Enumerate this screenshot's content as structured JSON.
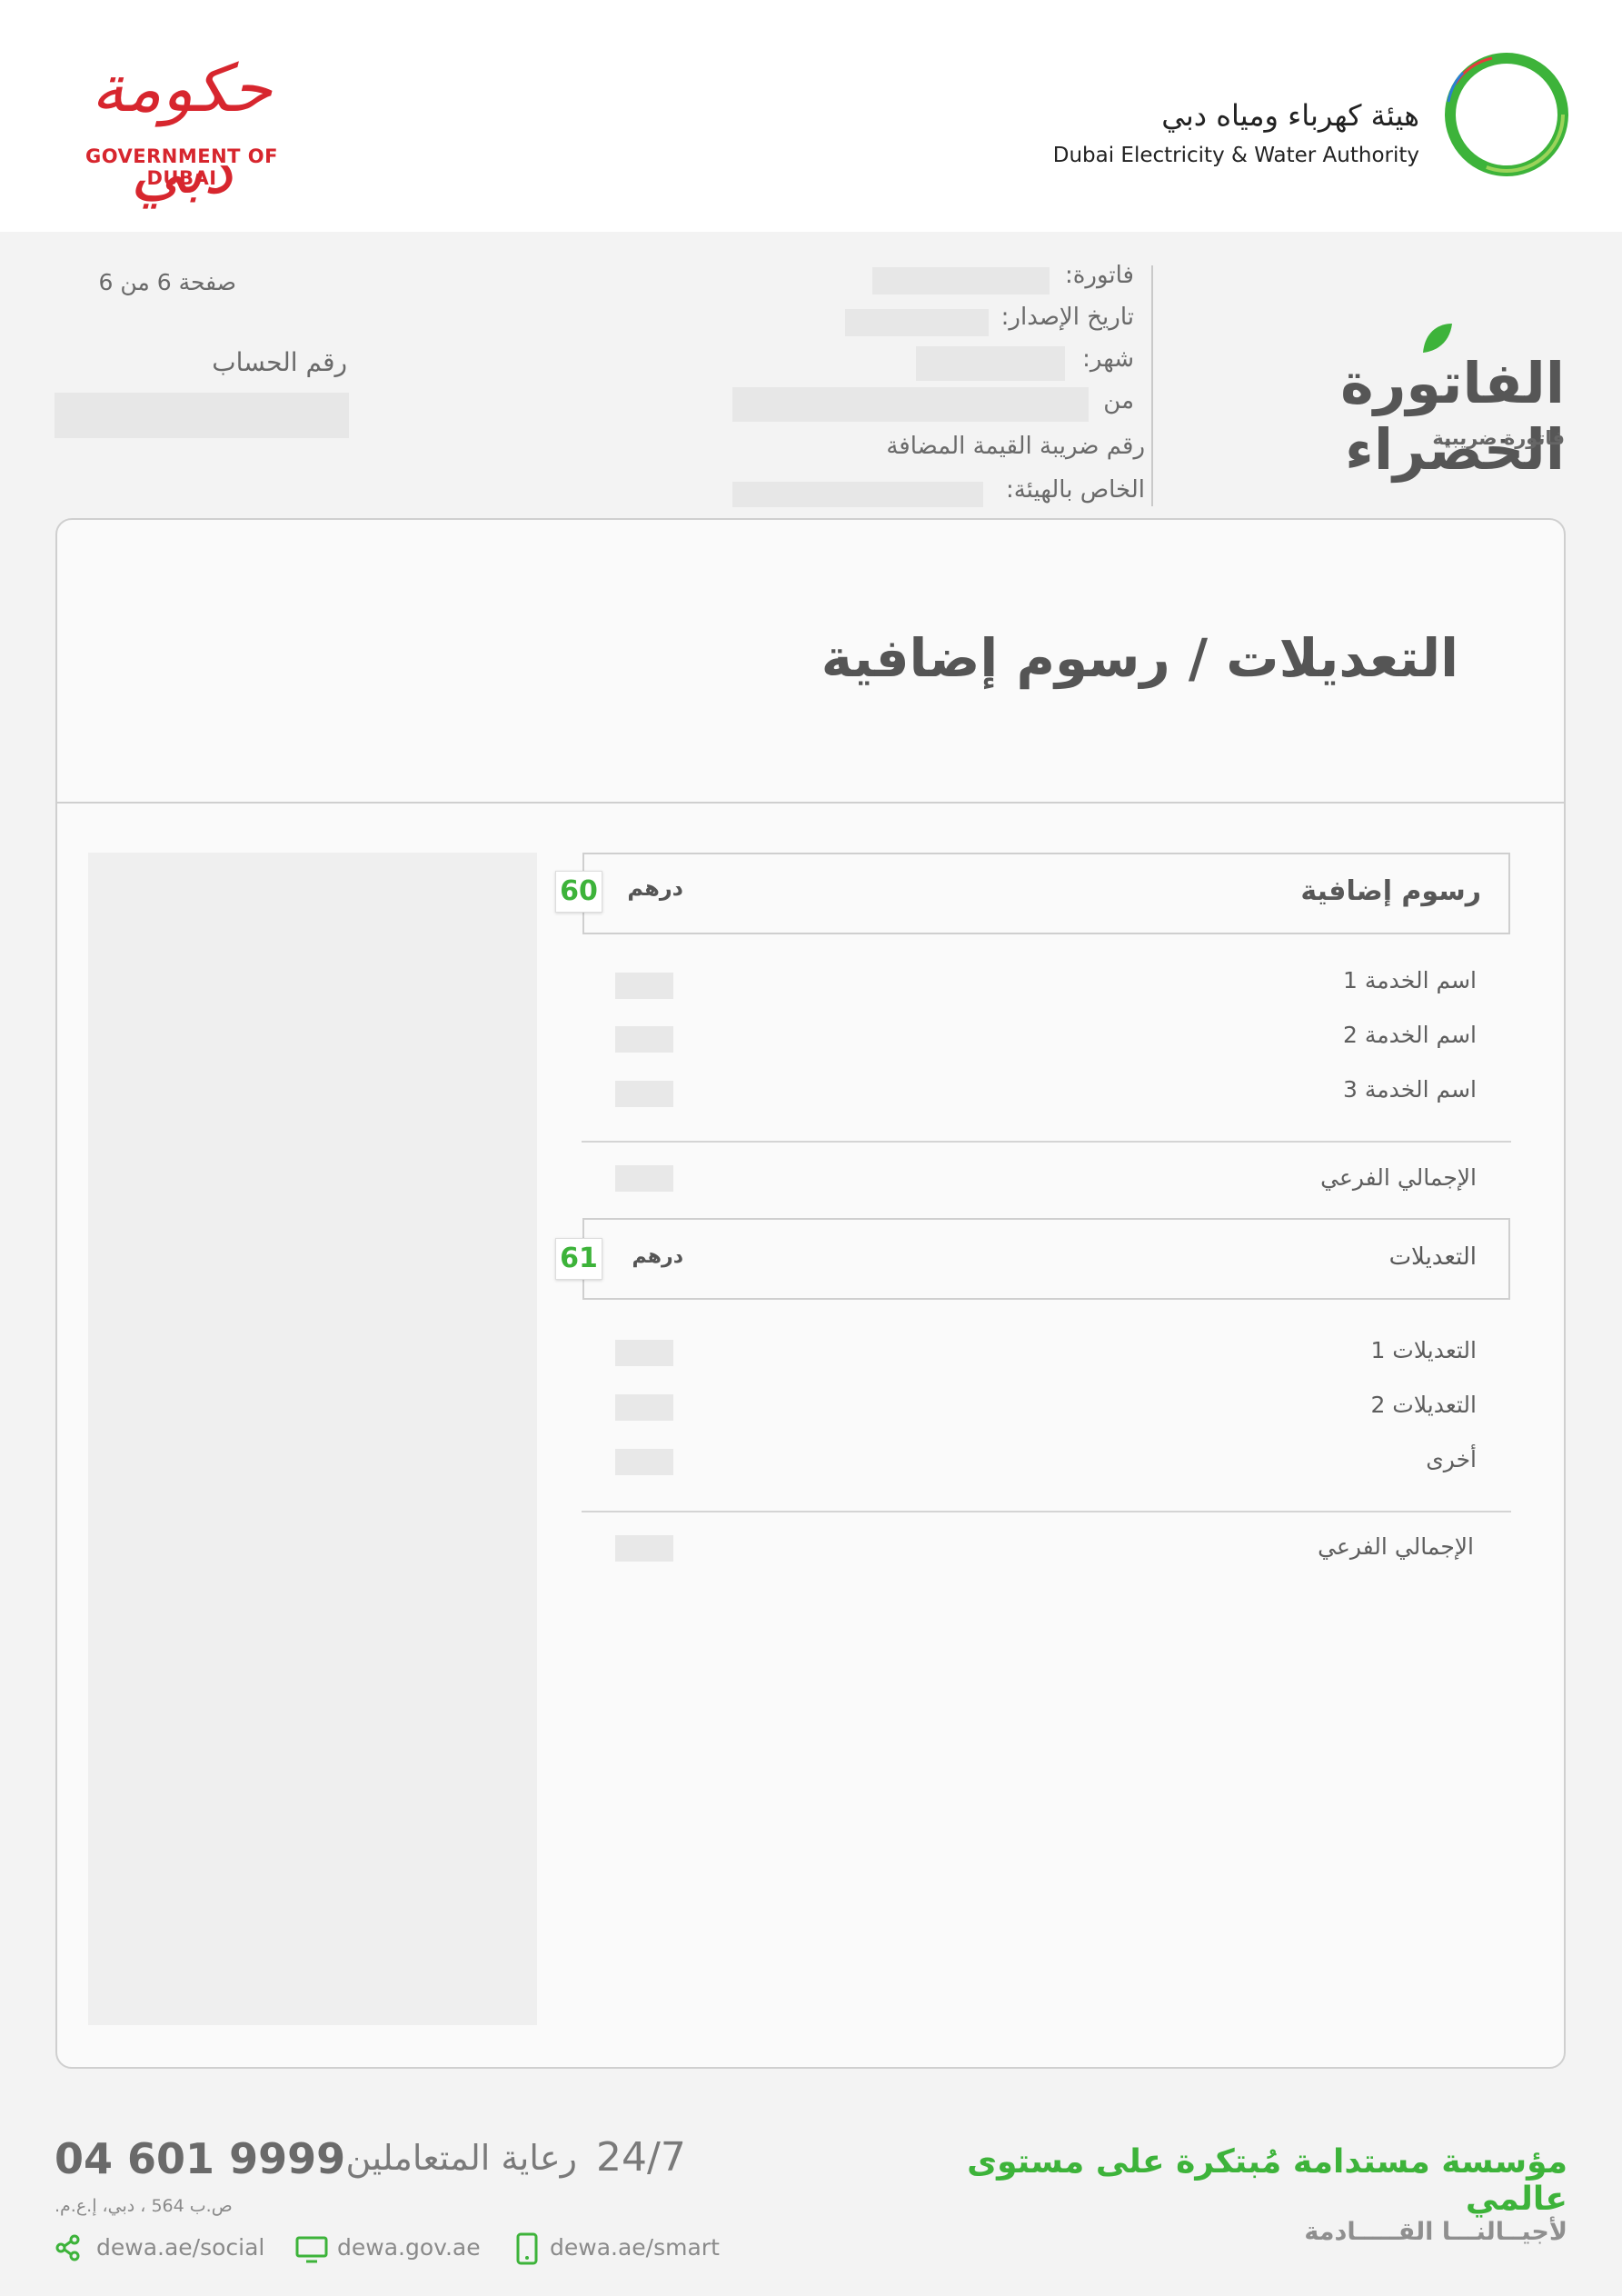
{
  "header": {
    "gov_logo_ar": "حكومة دبي",
    "gov_logo_en": "GOVERNMENT OF DUBAI",
    "dewa_name_ar": "هيئة كهرباء ومياه دبي",
    "dewa_name_en": "Dubai Electricity & Water Authority"
  },
  "bill_info": {
    "page_label": "صفحة",
    "page_current": "6",
    "page_of": "من",
    "page_total": "6",
    "account_label": "رقم الحساب",
    "invoice_label": "فاتورة:",
    "issue_date_label": "تاريخ الإصدار:",
    "month_label": "شهر:",
    "from_label": "من",
    "vat_label_line1": "رقم ضريبة القيمة المضافة",
    "vat_label_line2": "الخاص بالهيئة:",
    "green_bill_title": "الفاتورة الخضراء",
    "tax_invoice_label": "فاتورة ضريبية"
  },
  "card": {
    "title": "التعديلات / رسوم إضافية",
    "additional_fees": {
      "title": "رسوم إضافية",
      "currency": "درهم",
      "amount_code": "60",
      "rows": [
        {
          "label": "اسم الخدمة",
          "num": "1"
        },
        {
          "label": "اسم الخدمة",
          "num": "2"
        },
        {
          "label": "اسم الخدمة",
          "num": "3"
        }
      ],
      "subtotal_label": "الإجمالي الفرعي"
    },
    "adjustments": {
      "title": "التعديلات",
      "currency": "درهم",
      "amount_code": "61",
      "rows": [
        {
          "label": "التعديلات 1"
        },
        {
          "label": "التعديلات 2"
        },
        {
          "label": "أخرى"
        }
      ],
      "subtotal_label": "الإجمالي الفرعي"
    }
  },
  "footer": {
    "service_hours": "24/7",
    "customer_care_label": "رعاية المتعاملين",
    "phone": "04 601 9999",
    "po_box": "ص.ب 564 ، دبي، إ.ع.م.",
    "links": {
      "social": "dewa.ae/social",
      "web": "dewa.gov.ae",
      "smart": "dewa.ae/smart"
    },
    "slogan": "مؤسسة مستدامة مُبتكرة على مستوى عالمي",
    "tagline": "لأجيــالنـــا القـــــادمة"
  },
  "colors": {
    "accent_green": "#3db33a",
    "gov_red": "#d7262e",
    "band_gray": "#f3f3f3"
  }
}
